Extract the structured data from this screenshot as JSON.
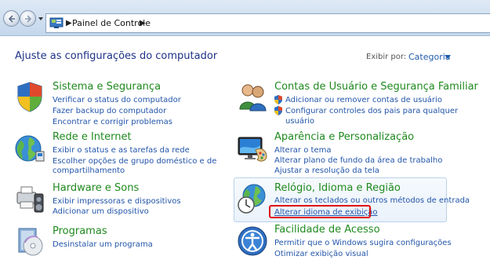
{
  "address_bar": {
    "location": "Painel de Controle"
  },
  "header": {
    "title": "Ajuste as configurações do computador",
    "view_by_label": "Exibir por:",
    "view_by_value": "Categoria"
  },
  "categories": [
    {
      "title": "Sistema e Segurança",
      "icon": "shield-flag-icon",
      "links": [
        "Verificar o status do computador",
        "Fazer backup do computador",
        "Encontrar e corrigir problemas"
      ]
    },
    {
      "title": "Rede e Internet",
      "icon": "globe-network-icon",
      "links": [
        "Exibir o status e as tarefas da rede",
        "Escolher opções de grupo doméstico e de",
        "compartilhamento"
      ]
    },
    {
      "title": "Hardware e Sons",
      "icon": "printer-speaker-icon",
      "links": [
        "Exibir impressoras e dispositivos",
        "Adicionar um dispositivo"
      ]
    },
    {
      "title": "Programas",
      "icon": "programs-disc-icon",
      "links": [
        "Desinstalar um programa"
      ]
    },
    {
      "title": "Contas de Usuário e Segurança Familiar",
      "icon": "users-icon",
      "links": [
        "Adicionar ou remover contas de usuário",
        "Configurar controles dos pais para qualquer",
        "usuário"
      ]
    },
    {
      "title": "Aparência e Personalização",
      "icon": "monitor-palette-icon",
      "links": [
        "Alterar o tema",
        "Alterar plano de fundo da área de trabalho",
        "Ajustar a resolução da tela"
      ]
    },
    {
      "title": "Relógio, Idioma e Região",
      "icon": "clock-globe-icon",
      "links": [
        "Alterar os teclados ou outros métodos de entrada",
        "Alterar idioma de exibição"
      ]
    },
    {
      "title": "Facilidade de Acesso",
      "icon": "accessibility-icon",
      "links": [
        "Permitir que o Windows sugira configurações",
        "Otimizar exibição visual"
      ]
    }
  ],
  "colors": {
    "category_title": "#1f8a1f",
    "link": "#2255aa",
    "heading": "#1e3287",
    "highlight_border": "#e01010"
  }
}
